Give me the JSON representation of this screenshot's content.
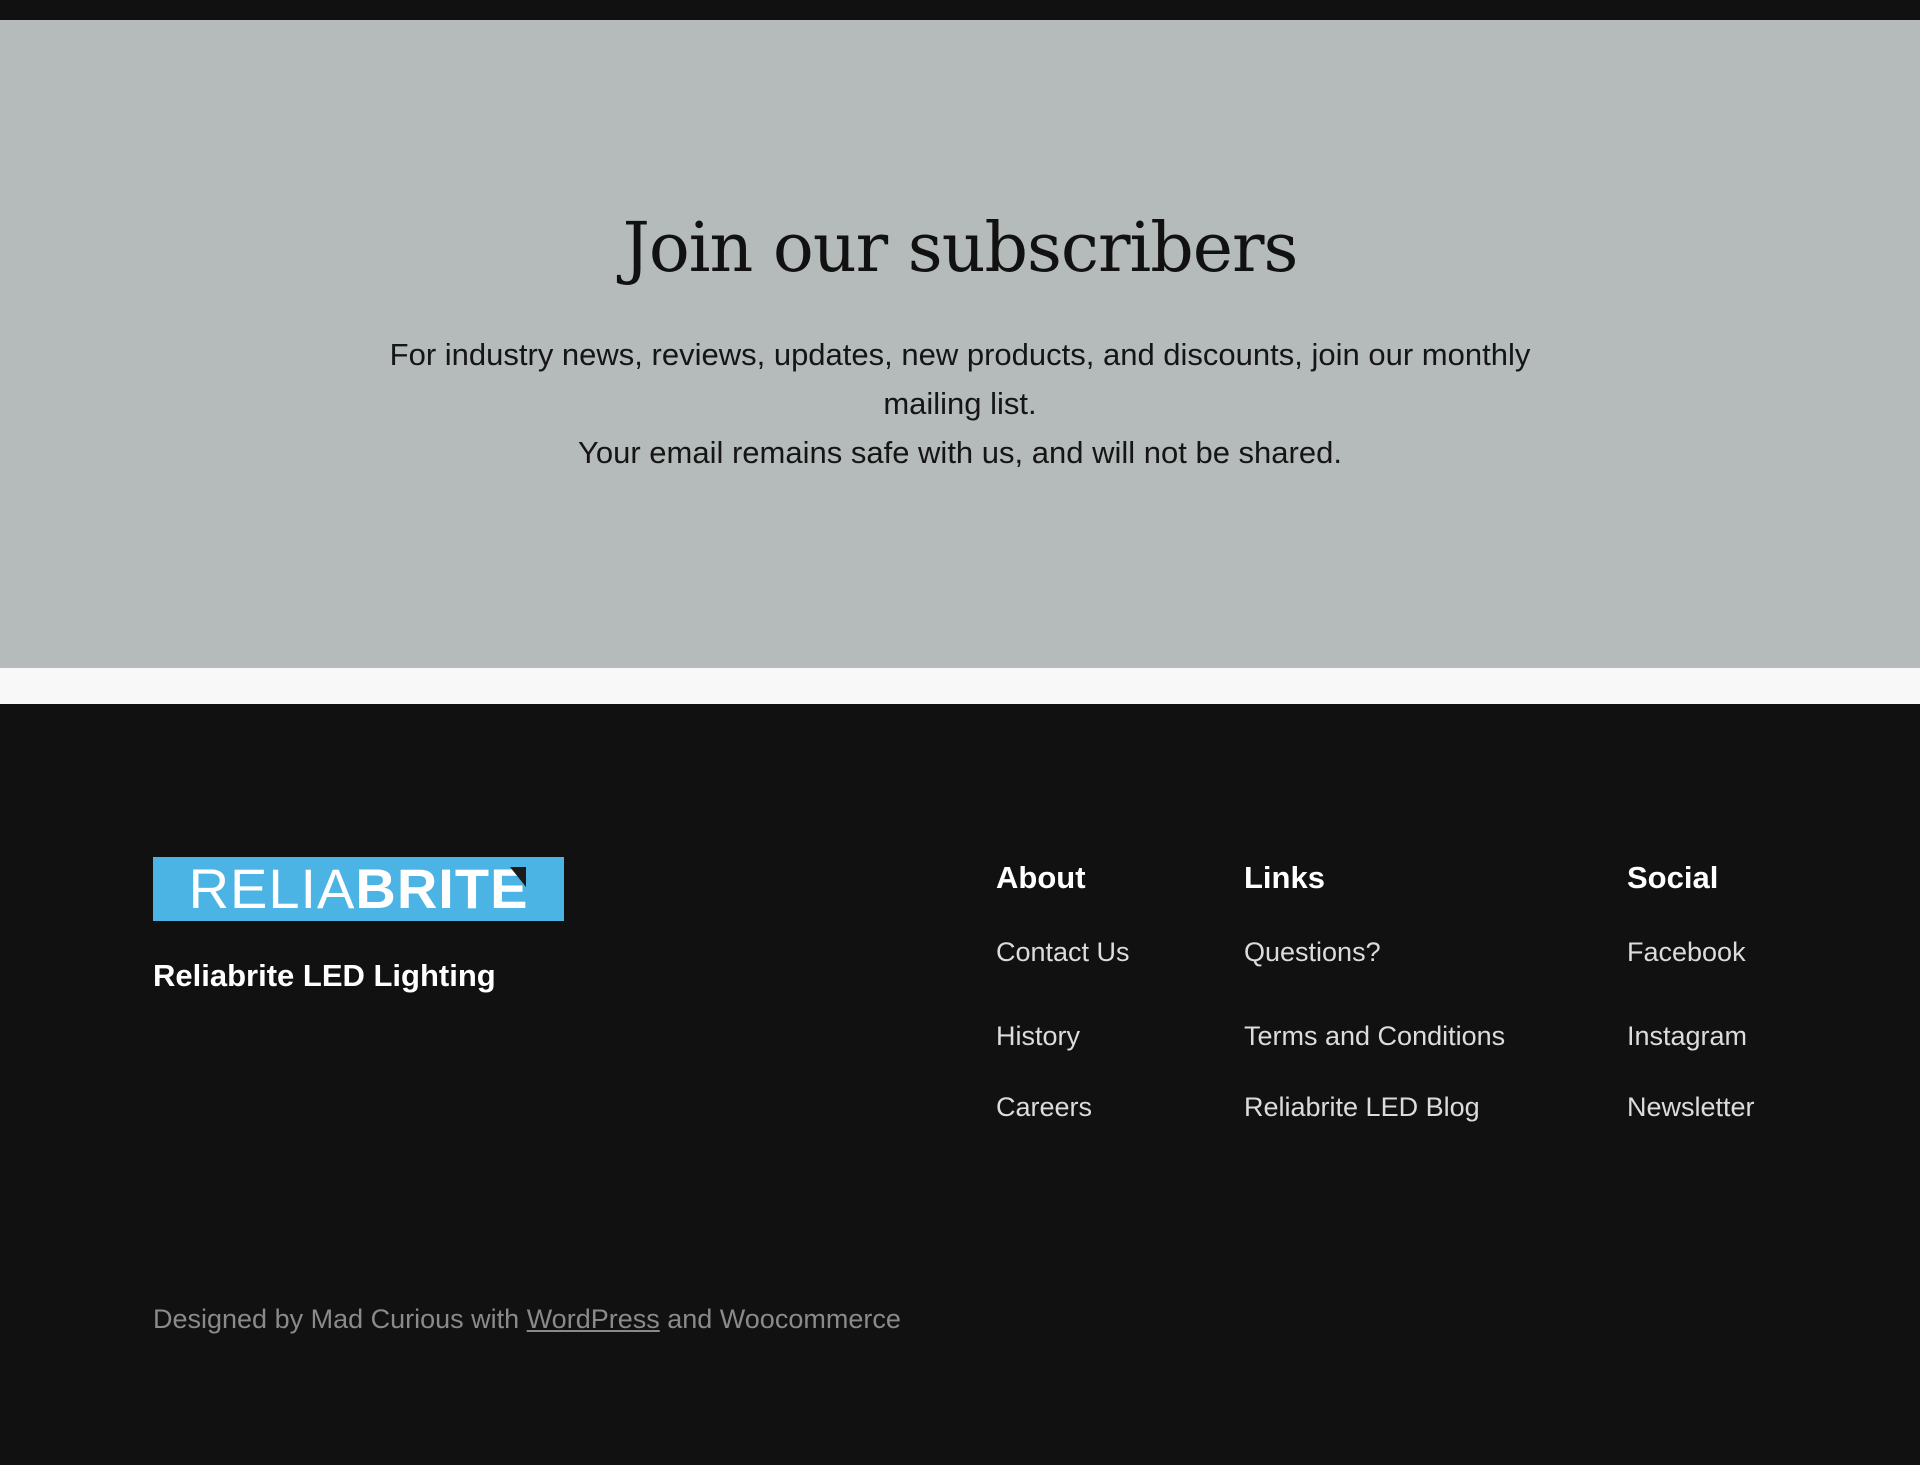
{
  "subscribe": {
    "title": "Join our subscribers",
    "line1": "For industry news, reviews, updates, new products, and discounts, join our monthly",
    "line2": "mailing list.",
    "line3": "Your email remains safe with us, and will not be shared.",
    "background": "#b5bbba"
  },
  "footer": {
    "logo": {
      "text_thin": "RELIA",
      "text_bold": "BRITE",
      "background": "#4cb4e4"
    },
    "site_name": "Reliabrite LED Lighting",
    "about": {
      "heading": "About",
      "items": [
        "Contact Us",
        "History",
        "Careers"
      ]
    },
    "links": {
      "heading": "Links",
      "items": [
        "Questions?",
        "Terms and Conditions",
        "Reliabrite LED Blog"
      ]
    },
    "social": {
      "heading": "Social",
      "items": [
        "Facebook",
        "Instagram",
        "Newsletter"
      ]
    },
    "credits": {
      "prefix": "Designed by Mad Curious with ",
      "link": "WordPress",
      "suffix": " and Woocommerce"
    }
  }
}
